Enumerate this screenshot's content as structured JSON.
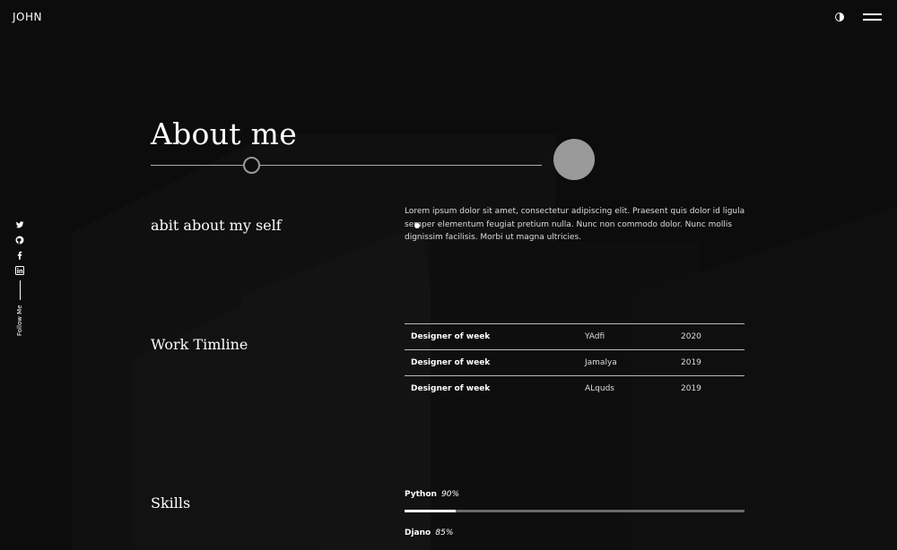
{
  "header": {
    "logo": "JOHN",
    "theme_toggle_icon": "half-circle-icon",
    "menu_icon": "hamburger-icon"
  },
  "social": {
    "icons": [
      "twitter-icon",
      "github-icon",
      "facebook-icon",
      "linkedin-icon"
    ],
    "follow_label": "Follow Me"
  },
  "about": {
    "title": "About me",
    "subtitle": "abit about my self",
    "text": "Lorem ipsum dolor sit amet, consectetur adipiscing elit. Praesent quis dolor id ligula semper elementum feugiat pretium nulla. Nunc non commodo dolor. Nunc mollis dignissim facilisis. Morbi ut magna ultricies."
  },
  "timeline": {
    "heading": "Work Timline",
    "rows": [
      {
        "role": "Designer of week",
        "company": "YAdfi",
        "year": "2020"
      },
      {
        "role": "Designer of week",
        "company": "Jamalya",
        "year": "2019"
      },
      {
        "role": "Designer of week",
        "company": "ALquds",
        "year": "2019"
      }
    ]
  },
  "skills": {
    "heading": "Skills",
    "items": [
      {
        "name": "Python",
        "percent_label": "90%",
        "level": 0.15
      },
      {
        "name": "Djano",
        "percent_label": "85%",
        "level": 0.85
      }
    ]
  },
  "colors": {
    "background": "#0c0c0c",
    "text": "#ffffff",
    "accent_gray": "#9a9a9a"
  }
}
